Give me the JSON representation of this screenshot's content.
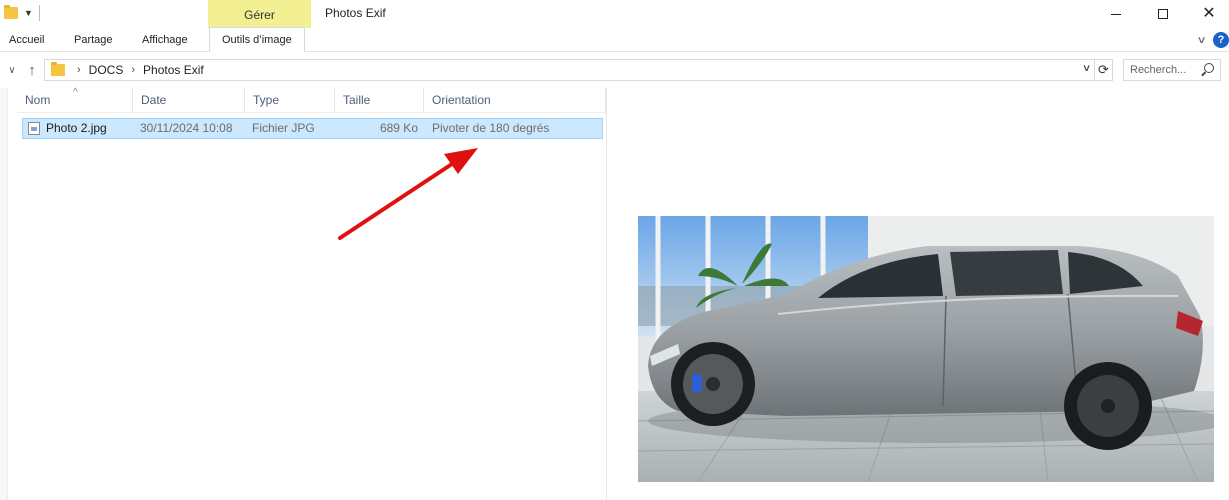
{
  "window": {
    "title": "Photos Exif",
    "context_group": "Gérer",
    "minimize_icon": "minimize-icon",
    "maximize_icon": "maximize-icon",
    "close_icon": "close-icon"
  },
  "ribbon": {
    "tabs": [
      {
        "label": "Accueil"
      },
      {
        "label": "Partage"
      },
      {
        "label": "Affichage"
      },
      {
        "label": "Outils d’image"
      }
    ],
    "help_glyph": "?"
  },
  "navigation": {
    "breadcrumb": [
      "DOCS",
      "Photos Exif"
    ],
    "search_placeholder": "Recherch..."
  },
  "file_list": {
    "columns": [
      {
        "label": "Nom"
      },
      {
        "label": "Date"
      },
      {
        "label": "Type"
      },
      {
        "label": "Taille"
      },
      {
        "label": "Orientation"
      }
    ],
    "rows": [
      {
        "name": "Photo 2.jpg",
        "date": "30/11/2024 10:08",
        "type": "Fichier JPG",
        "size": "689 Ko",
        "orientation": "Pivoter de 180 degrés",
        "selected": true
      }
    ]
  },
  "colors": {
    "selection_bg": "#cce8ff",
    "selection_border": "#99d1ff",
    "context_tab": "#f3f094",
    "header_text": "#4c607a",
    "annotation_arrow": "#e01010"
  }
}
